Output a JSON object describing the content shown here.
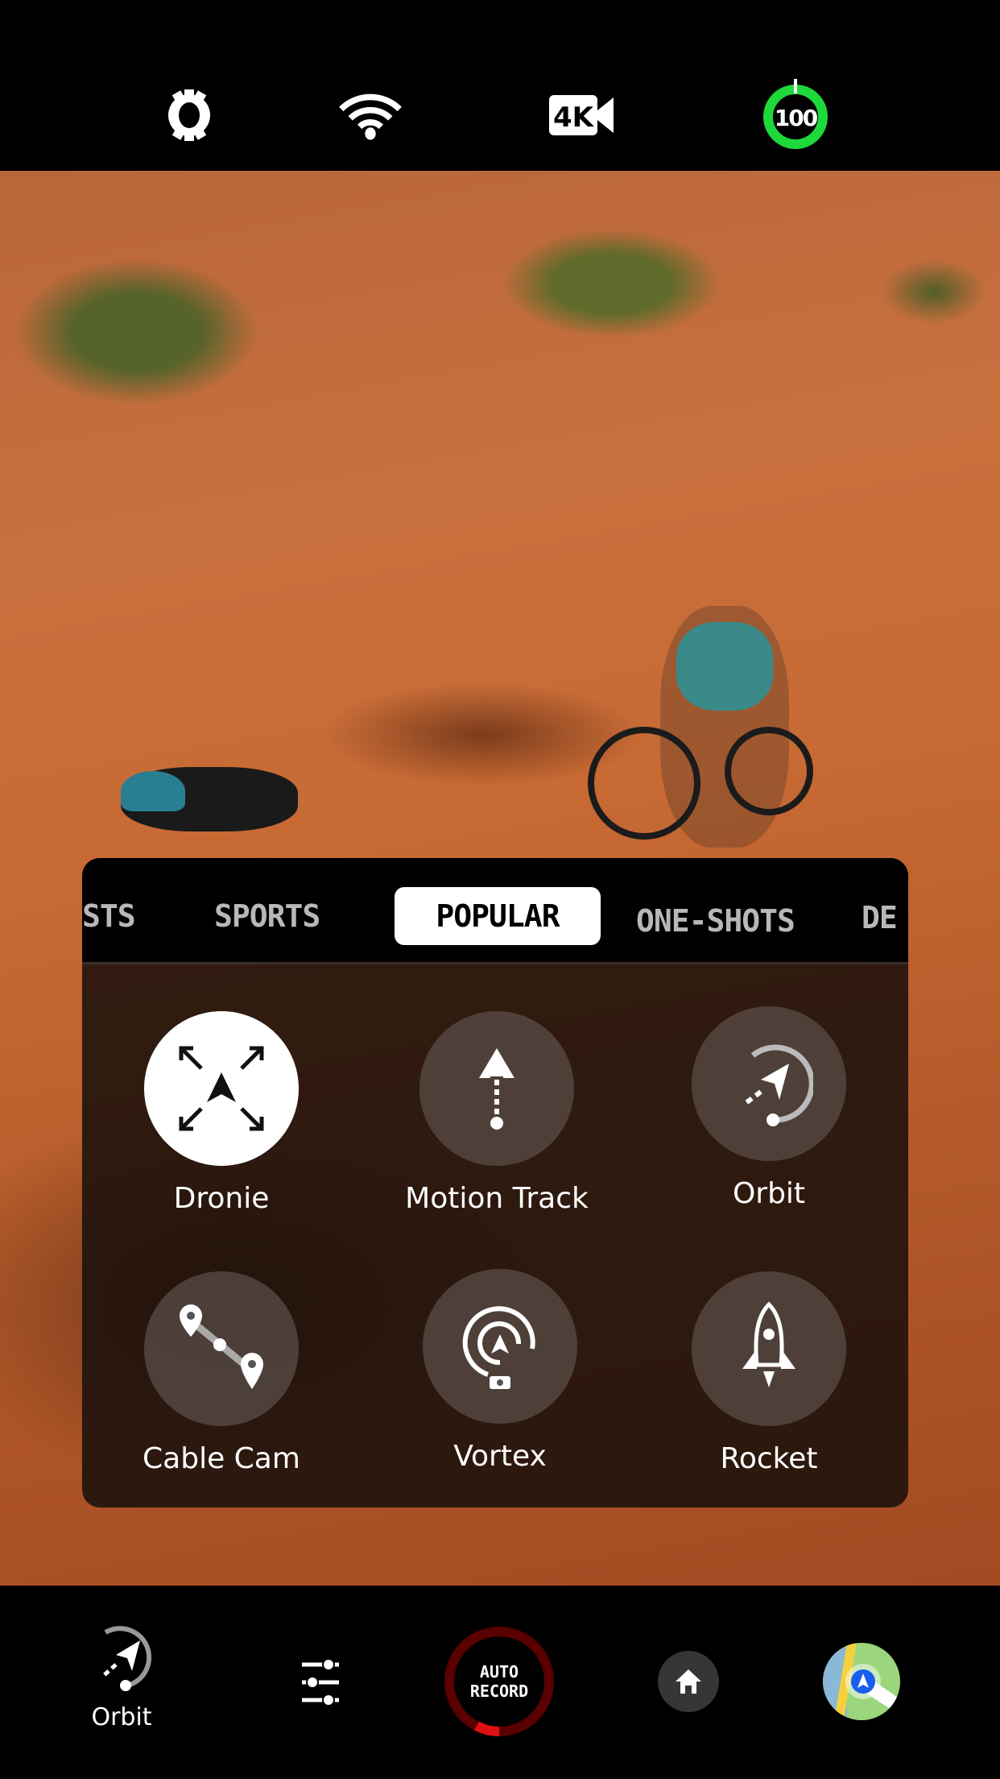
{
  "status_bar": {
    "settings_icon": "gear-icon",
    "wifi_icon": "wifi-icon",
    "video_quality": "4K",
    "battery_level": 100,
    "battery_color": "#1fd83a"
  },
  "mode_panel": {
    "tabs": [
      {
        "label": "STS"
      },
      {
        "label": "SPORTS"
      },
      {
        "label": "POPULAR",
        "active": true
      },
      {
        "label": "ONE-SHOTS"
      },
      {
        "label": "DE"
      }
    ],
    "modes": [
      {
        "label": "Dronie",
        "icon": "dronie-expand-icon",
        "selected": true
      },
      {
        "label": "Motion Track",
        "icon": "motion-track-icon"
      },
      {
        "label": "Orbit",
        "icon": "orbit-icon"
      },
      {
        "label": "Cable Cam",
        "icon": "cable-cam-icon"
      },
      {
        "label": "Vortex",
        "icon": "vortex-icon"
      },
      {
        "label": "Rocket",
        "icon": "rocket-icon"
      }
    ]
  },
  "bottom_bar": {
    "current_mode": "Orbit",
    "auto_record_line1": "AUTO",
    "auto_record_line2": "RECORD",
    "record_color": "#e01010",
    "home_icon": "home-icon",
    "map_icon": "map-icon",
    "settings_icon": "sliders-icon"
  }
}
